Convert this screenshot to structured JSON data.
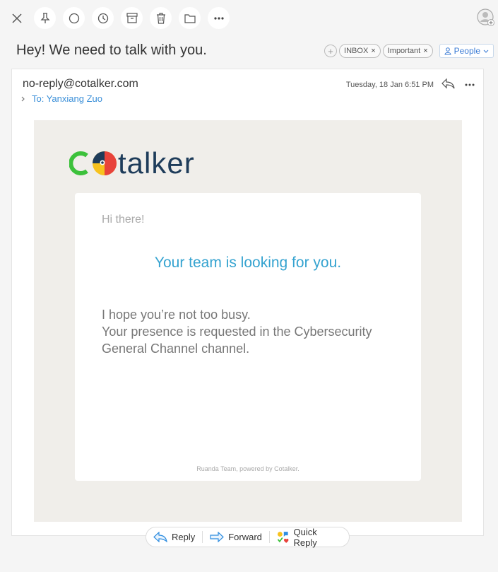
{
  "toolbar": {
    "buttons": [
      "close-icon",
      "pin-icon",
      "circle-icon",
      "clock-icon",
      "archive-icon",
      "trash-icon",
      "folder-icon",
      "more-icon"
    ]
  },
  "message": {
    "subject": "Hey! We need to talk with you.",
    "tags": [
      "INBOX",
      "Important"
    ],
    "tag_add": "+",
    "tag_remove": "×",
    "people_label": "People",
    "from": "no-reply@cotalker.com",
    "to_label": "To: Yanxiang Zuo",
    "date": "Tuesday, 18 Jan 6:51 PM",
    "more": "•••"
  },
  "body": {
    "logo_text": "talker",
    "greeting": "Hi there!",
    "headline": "Your team is looking for you.",
    "line1": "I hope you’re not too busy.",
    "line2": "Your presence is requested in the Cybersecurity General Channel channel.",
    "footer": "Ruanda Team, powered by Cotalker."
  },
  "actions": {
    "reply": "Reply",
    "forward": "Forward",
    "quick_reply": "Quick Reply"
  },
  "colors": {
    "accent_blue": "#3a8fd8",
    "headline_blue": "#35a3d0",
    "logo_navy": "#1e3c5a",
    "logo_green": "#3cc13b",
    "logo_yellow": "#f7c21e",
    "logo_red": "#e8433b",
    "body_bg": "#f0eeea"
  }
}
